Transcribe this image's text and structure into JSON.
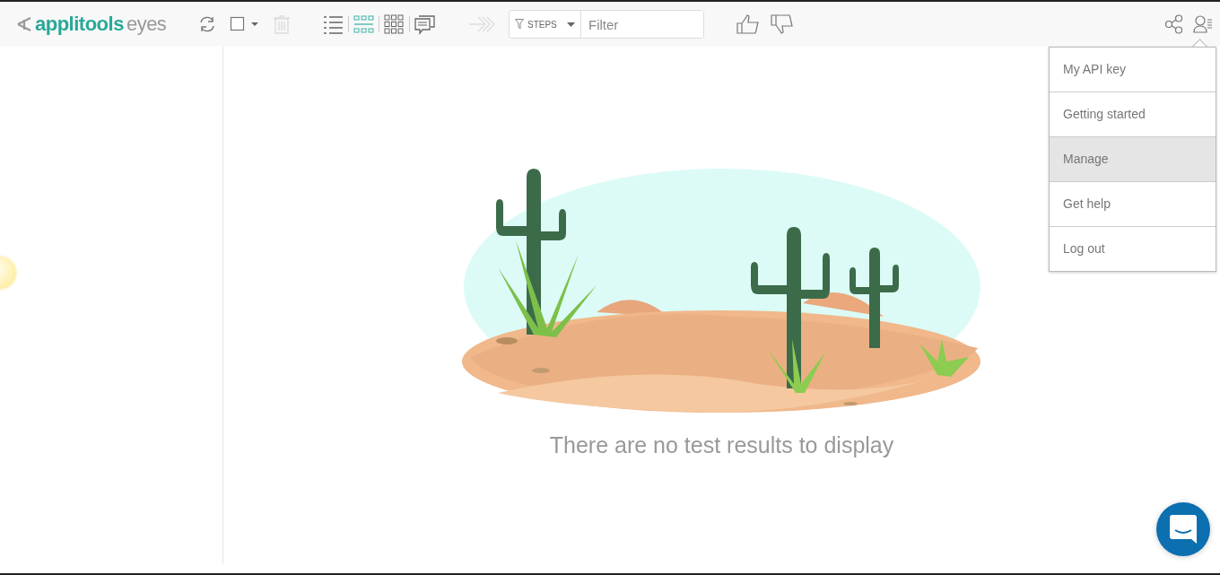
{
  "logo": {
    "brand": "applitools",
    "product": "eyes"
  },
  "toolbar": {
    "select_all": {
      "checked": false
    },
    "view_modes": [
      {
        "kind": "list",
        "selected": false
      },
      {
        "kind": "tiles",
        "selected": true
      },
      {
        "kind": "grid",
        "selected": false
      },
      {
        "kind": "comments",
        "selected": false
      }
    ],
    "filter": {
      "scope": "STEPS",
      "placeholder": "Filter"
    }
  },
  "user_menu": {
    "items": [
      {
        "label": "My API key",
        "selected": false
      },
      {
        "label": "Getting started",
        "selected": false
      },
      {
        "label": "Manage",
        "selected": true
      },
      {
        "label": "Get help",
        "selected": false
      },
      {
        "label": "Log out",
        "selected": false
      }
    ]
  },
  "empty_state": {
    "message": "There are no test results to display"
  }
}
